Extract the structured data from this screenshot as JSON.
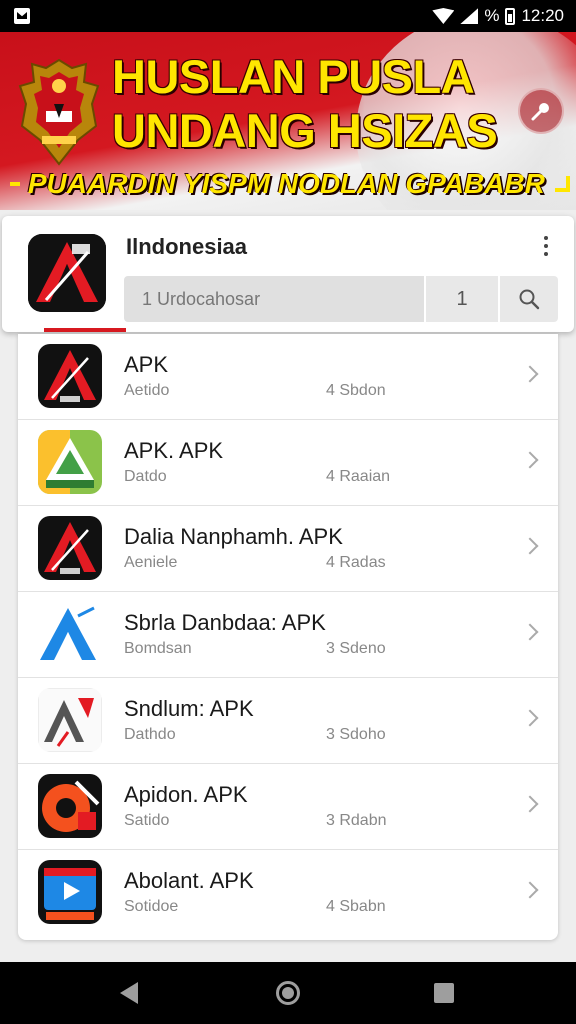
{
  "status_bar": {
    "battery_text": "%",
    "time": "12:20"
  },
  "banner": {
    "title_line1": "HUSLAN PUSLA",
    "title_line2": "UNDANG HSIZAS",
    "subtitle": "PUAARDIN YISPM NODLAN GPABABR"
  },
  "search_card": {
    "title": "Ilndonesiaa",
    "search_value": "1 Urdocahosar",
    "count": "1"
  },
  "apps": [
    {
      "title": "APK",
      "subtitle": "Aetido",
      "meta": "4 Sbdon",
      "icon": "red-a-logo-icon"
    },
    {
      "title": "APK. APK",
      "subtitle": "Datdo",
      "meta": "4 Raaian",
      "icon": "green-triangle-logo-icon"
    },
    {
      "title": "Dalia Nanphamh. APK",
      "subtitle": "Aeniele",
      "meta": "4 Radas",
      "icon": "red-a-logo-icon"
    },
    {
      "title": "Sbrla Danbdaa: APK",
      "subtitle": "Bomdsan",
      "meta": "3 Sdeno",
      "icon": "blue-a-logo-icon"
    },
    {
      "title": "Sndlum: APK",
      "subtitle": "Dathdo",
      "meta": "3 Sdoho",
      "icon": "white-a-logo-icon"
    },
    {
      "title": "Apidon. APK",
      "subtitle": "Satido",
      "meta": "3 Rdabn",
      "icon": "orange-circle-logo-icon"
    },
    {
      "title": "Abolant. APK",
      "subtitle": "Sotidoe",
      "meta": "4 Sbabn",
      "icon": "play-video-logo-icon"
    }
  ],
  "colors": {
    "accent_red": "#d71920",
    "banner_yellow": "#ffe600"
  }
}
